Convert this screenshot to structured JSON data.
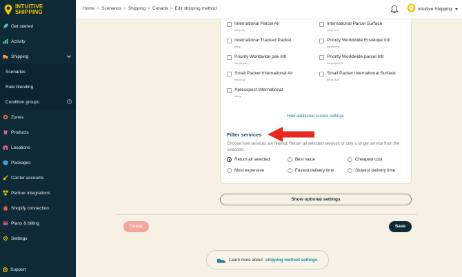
{
  "brand": {
    "line1": "INTUITIVE",
    "line2": "SHIPPING"
  },
  "sidebar": {
    "items": [
      {
        "label": "Get started",
        "icon": "rocket-icon",
        "color": "#5bc0de"
      },
      {
        "label": "Activity",
        "icon": "chart-icon",
        "color": "#6fd3a0"
      },
      {
        "label": "Shipping",
        "icon": "truck-icon",
        "color": "#f6a04d"
      },
      {
        "label": "Scenarios"
      },
      {
        "label": "Rate blending"
      },
      {
        "label": "Condition groups"
      },
      {
        "label": "Zones",
        "icon": "zones-icon",
        "color": "#f0623b"
      },
      {
        "label": "Products",
        "icon": "products-icon",
        "color": "#e05a8a"
      },
      {
        "label": "Locations",
        "icon": "locations-icon",
        "color": "#e05a8a"
      },
      {
        "label": "Packages",
        "icon": "package-icon",
        "color": "#4aa3df"
      },
      {
        "label": "Carrier accounts",
        "icon": "key-icon",
        "color": "#f4c400"
      },
      {
        "label": "Partner integrations",
        "icon": "partner-icon",
        "color": "#f4c400"
      },
      {
        "label": "Shopify connection",
        "icon": "shopify-icon",
        "color": "#f0623b"
      },
      {
        "label": "Plans & billing",
        "icon": "billing-icon",
        "color": "#e05a8a"
      },
      {
        "label": "Settings",
        "icon": "gear-icon",
        "color": "#f4c400"
      }
    ],
    "support": "Support"
  },
  "header": {
    "breadcrumb": [
      "Home",
      "Scenarios",
      "Shipping",
      "Canada",
      "Edit shipping method"
    ],
    "account": "Intuitive Shipping"
  },
  "services": {
    "left": [
      {
        "name": "International Parcel Air",
        "code": "intl.ip.air"
      },
      {
        "name": "International Tracked Packet",
        "code": "intl.tp"
      },
      {
        "name": "Priority Worldwide pak Intl",
        "code": "intl.pw.pak"
      },
      {
        "name": "Small Packet International Air",
        "code": "intl.sp.air"
      },
      {
        "name": "Xpresspost International",
        "code": "intl.xp"
      }
    ],
    "right": [
      {
        "name": "International Parcel Surface",
        "code": "intl.ip.surf"
      },
      {
        "name": "Priority Worldwide Envelope Intl",
        "code": "intl.pw.env"
      },
      {
        "name": "Priority Worldwide parcel Intl",
        "code": "intl.pw.parcel"
      },
      {
        "name": "Small Packet International Surface",
        "code": "intl.sp.surf"
      }
    ],
    "hide_link": "Hide additional service settings"
  },
  "filter": {
    "title": "Filter services",
    "description": "Choose how services are filtered. Return all selected services or only a single service from the selection.",
    "options": [
      "Return all selected",
      "Best value",
      "Cheapest cost",
      "Most expensive",
      "Fastest delivery time",
      "Slowest delivery time"
    ],
    "selected": "Return all selected"
  },
  "buttons": {
    "optional": "Show optional settings",
    "delete": "Delete",
    "save": "Save"
  },
  "learn": {
    "prefix": "Learn more about",
    "link": "shipping method settings",
    "suffix": "."
  },
  "colors": {
    "sidebar_bg": "#0d2a36",
    "accent": "#f4c400",
    "link": "#1c8aa3",
    "delete": "#f4a59d",
    "arrow": "#e8271e"
  }
}
